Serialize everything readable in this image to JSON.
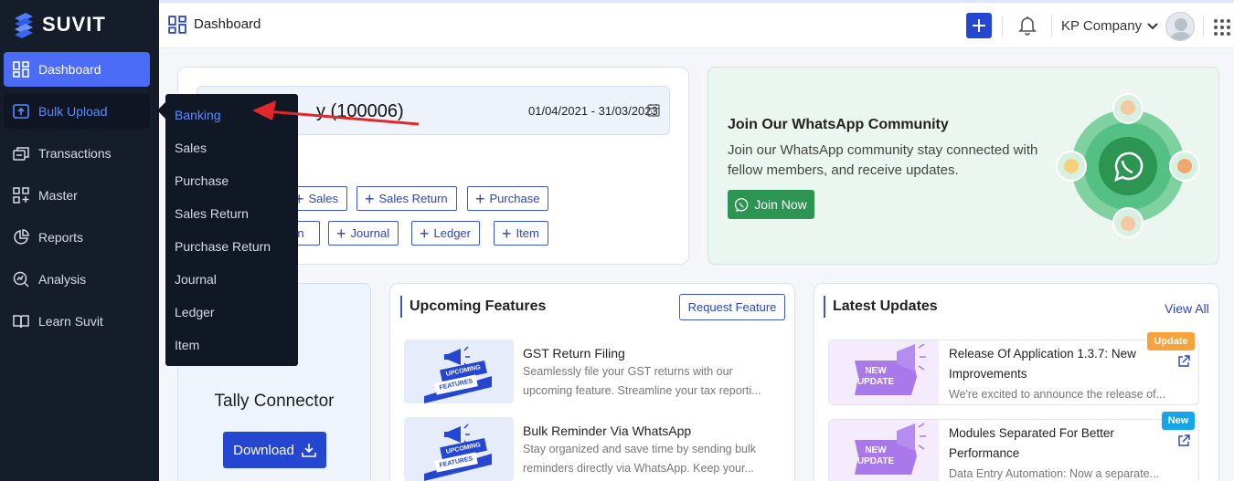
{
  "app": {
    "logo_text": "SUVIT"
  },
  "sidebar": {
    "items": [
      {
        "label": "Dashboard",
        "icon": "dashboard-icon"
      },
      {
        "label": "Bulk Upload",
        "icon": "upload-icon"
      },
      {
        "label": "Transactions",
        "icon": "transactions-icon"
      },
      {
        "label": "Master",
        "icon": "master-icon"
      },
      {
        "label": "Reports",
        "icon": "reports-icon"
      },
      {
        "label": "Analysis",
        "icon": "analysis-icon"
      },
      {
        "label": "Learn Suvit",
        "icon": "book-icon"
      }
    ]
  },
  "flyout": {
    "items": [
      "Banking",
      "Sales",
      "Purchase",
      "Sales Return",
      "Purchase Return",
      "Journal",
      "Ledger",
      "Item"
    ],
    "selected": "Banking"
  },
  "header": {
    "title": "Dashboard",
    "company": "KP Company"
  },
  "company_card": {
    "name_visible": "y (100006)",
    "fy": "01/04/2021 - 31/03/2023",
    "buttons_row1": [
      "Sales",
      "Sales Return",
      "Purchase"
    ],
    "buttons_row2": [
      "rn",
      "Journal",
      "Ledger",
      "Item"
    ]
  },
  "whatsapp": {
    "title": "Join Our WhatsApp Community",
    "text": "Join our WhatsApp community stay connected with fellow members, and receive updates.",
    "button": "Join Now"
  },
  "tally": {
    "title": "Tally Connector",
    "button": "Download"
  },
  "upcoming": {
    "title": "Upcoming Features",
    "request_button": "Request Feature",
    "thumb_label_1": "UPCOMING",
    "thumb_label_2": "FEATURES",
    "items": [
      {
        "title": "GST Return Filing",
        "desc_line1": "Seamlessly file your GST returns with our",
        "desc_line2": "upcoming feature. Streamline your tax reporti..."
      },
      {
        "title": "Bulk Reminder Via WhatsApp",
        "desc_line1": "Stay organized and save time by sending bulk",
        "desc_line2": "reminders directly via WhatsApp. Keep your..."
      }
    ]
  },
  "updates": {
    "title": "Latest Updates",
    "view_all": "View All",
    "thumb_label_1": "NEW",
    "thumb_label_2": "UPDATE",
    "items": [
      {
        "title": "Release Of Application 1.3.7: New Improvements",
        "desc": "We're excited to announce the release of...",
        "badge": "Update",
        "badge_color": "#f7a23b"
      },
      {
        "title": "Modules Separated For Better Performance",
        "desc": "Data Entry Automation: Now a separate...",
        "badge": "New",
        "badge_color": "#14a6e8"
      }
    ]
  },
  "colors": {
    "primary": "#2446d1",
    "sidebar": "#151d2b",
    "whatsapp": "#2c9552"
  }
}
